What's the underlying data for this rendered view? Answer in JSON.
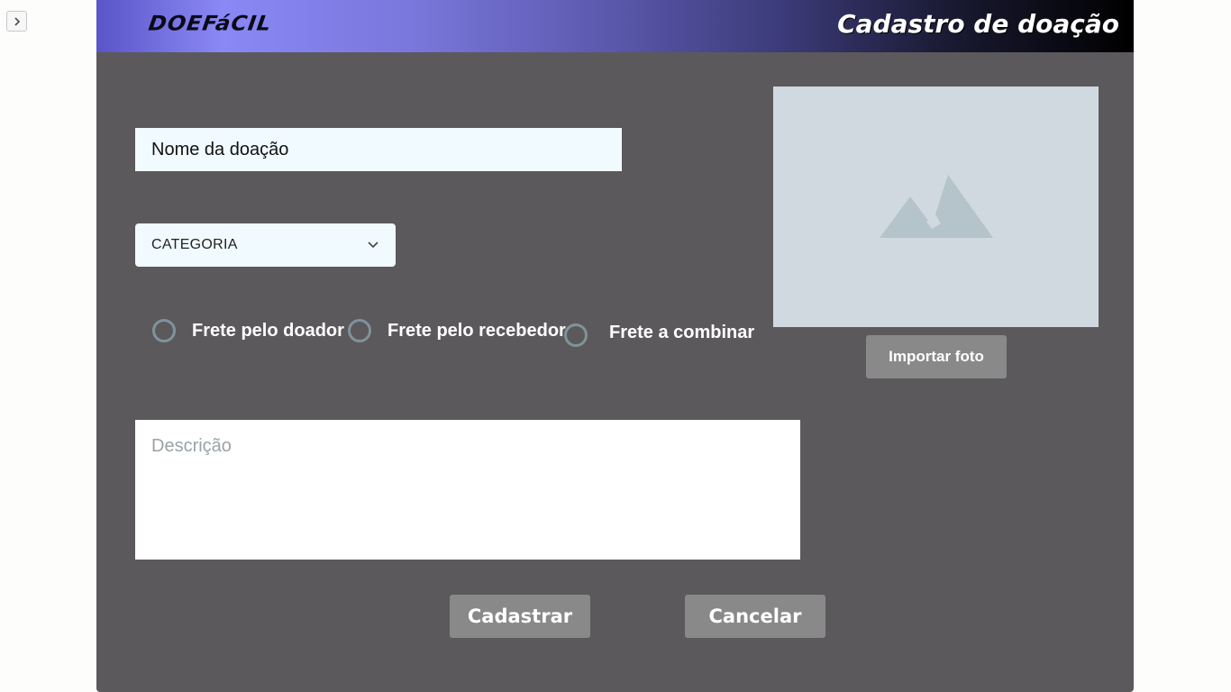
{
  "header": {
    "logo_text": "DOEFáCIL",
    "title": "Cadastro de doação",
    "gradient_colors": [
      "#5a55c8",
      "#8a88f5",
      "#3c3b7a",
      "#000000"
    ]
  },
  "sidebar_toggle": {
    "icon": "chevron-right-icon",
    "glyph": "›"
  },
  "form": {
    "name_placeholder": "Nome da doação",
    "category": {
      "label": "CATEGORIA",
      "icon": "chevron-down-icon"
    },
    "shipping_options": [
      {
        "label": "Frete pelo doador"
      },
      {
        "label": "Frete pelo recebedor"
      },
      {
        "label": "Frete a combinar"
      }
    ],
    "description_placeholder": "Descrição"
  },
  "photo": {
    "icon": "image-placeholder-icon",
    "import_label": "Importar foto"
  },
  "actions": {
    "submit_label": "Cadastrar",
    "cancel_label": "Cancelar"
  },
  "colors": {
    "panel_bg": "#5b595c",
    "button_bg": "#8a898a",
    "input_bg": "#f1fafe",
    "photo_bg": "#d1d9e0"
  }
}
